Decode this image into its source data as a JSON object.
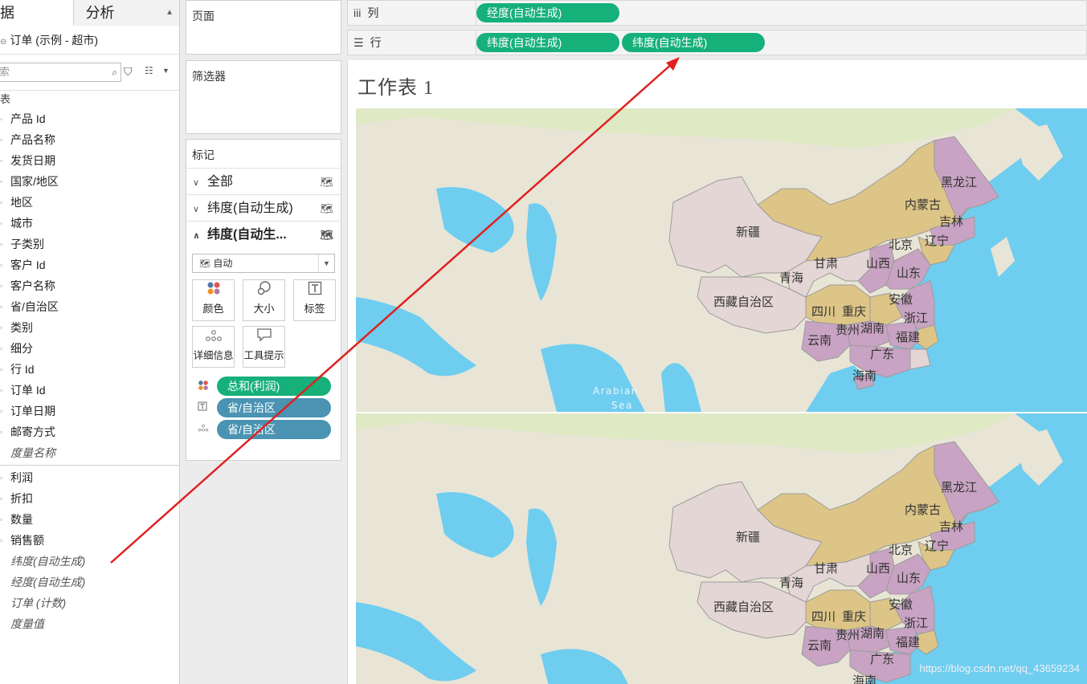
{
  "tabs": {
    "data": "据",
    "analysis": "分析"
  },
  "datasource": "订单 (示例 - 超市)",
  "search": {
    "placeholder": "索"
  },
  "dimensions_header": "表",
  "dimensions": [
    "产品 Id",
    "产品名称",
    "发货日期",
    "国家/地区",
    "地区",
    "城市",
    "子类别",
    "客户 Id",
    "客户名称",
    "省/自治区",
    "类别",
    "细分",
    "行 Id",
    "订单 Id",
    "订单日期",
    "邮寄方式"
  ],
  "dimension_italic": "度量名称",
  "measures": [
    "利润",
    "折扣",
    "数量",
    "销售额"
  ],
  "measures_italic": [
    "纬度(自动生成)",
    "经度(自动生成)",
    "订单 (计数)",
    "度量值"
  ],
  "pages_title": "页面",
  "filters_title": "筛选器",
  "marks": {
    "title": "标记",
    "rows": [
      "全部",
      "纬度(自动生成)",
      "纬度(自动生..."
    ],
    "mark_type": "自动",
    "buttons": {
      "color": "颜色",
      "size": "大小",
      "label": "标签",
      "detail": "详细信息",
      "tooltip": "工具提示"
    },
    "pills": [
      "总和(利润)",
      "省/自治区",
      "省/自治区"
    ]
  },
  "shelves": {
    "columns_label": "列",
    "rows_label": "行",
    "columns_pills": [
      "经度(自动生成)"
    ],
    "rows_pills": [
      "纬度(自动生成)",
      "纬度(自动生成)"
    ]
  },
  "worksheet_title": "工作表 1",
  "map": {
    "sea_label": [
      "Arabian",
      "Sea"
    ],
    "provinces": [
      "黑龙江",
      "内蒙古",
      "吉林",
      "辽宁",
      "北京",
      "新疆",
      "甘肃",
      "山西",
      "山东",
      "青海",
      "西藏自治区",
      "安徽",
      "四川",
      "重庆",
      "浙江",
      "贵州",
      "湖南",
      "福建",
      "云南",
      "广东",
      "海南"
    ]
  },
  "watermark": "https://blog.csdn.net/qq_43659234",
  "colors": {
    "green_pill": "#16b07a",
    "blue_pill": "#4a93b2",
    "arrow": "#e02020",
    "sea": "#6fcdf0",
    "land": "#e8e5d6",
    "purple": "#c9a3c3",
    "tan": "#dcc587"
  }
}
